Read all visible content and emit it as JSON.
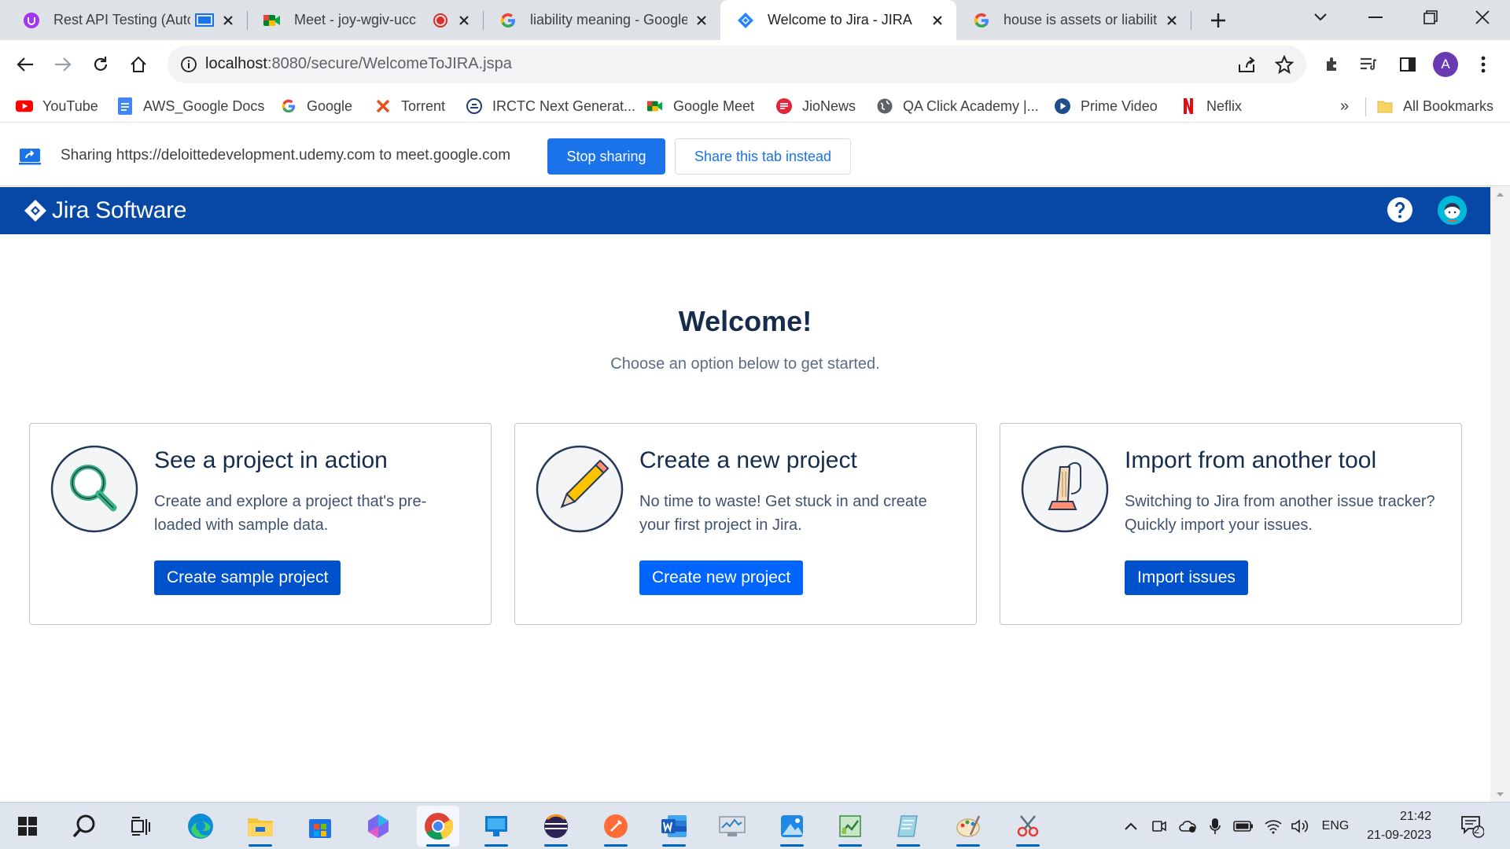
{
  "browser": {
    "tabs": [
      {
        "title": "Rest API Testing (Auto",
        "icon": "udemy-icon"
      },
      {
        "title": "Meet - joy-wgiv-ucc",
        "icon": "google-meet-icon"
      },
      {
        "title": "liability meaning - Google",
        "icon": "google-icon"
      },
      {
        "title": "Welcome to Jira - JIRA",
        "icon": "jira-icon",
        "active": true
      },
      {
        "title": "house is assets or liabilitie",
        "icon": "google-icon"
      }
    ],
    "url_host": "localhost",
    "url_path": ":8080/secure/WelcomeToJIRA.jspa",
    "profile_initial": "A"
  },
  "bookmarks": {
    "items": [
      {
        "label": "YouTube",
        "icon": "youtube-icon"
      },
      {
        "label": "AWS_Google Docs",
        "icon": "google-docs-icon"
      },
      {
        "label": "Google",
        "icon": "google-icon"
      },
      {
        "label": "Torrent",
        "icon": "torrent-icon"
      },
      {
        "label": "IRCTC Next Generat...",
        "icon": "irctc-icon"
      },
      {
        "label": "Google Meet",
        "icon": "google-meet-icon"
      },
      {
        "label": "JioNews",
        "icon": "jionews-icon"
      },
      {
        "label": "QA Click Academy |...",
        "icon": "globe-icon"
      },
      {
        "label": "Prime Video",
        "icon": "prime-video-icon"
      },
      {
        "label": "Neflix",
        "icon": "netflix-icon"
      }
    ],
    "overflow": "»",
    "all_bookmarks": "All Bookmarks"
  },
  "share_bar": {
    "text": "Sharing https://deloittedevelopment.udemy.com to meet.google.com",
    "stop_label": "Stop sharing",
    "share_tab_label": "Share this tab instead"
  },
  "jira": {
    "product_name": "Jira Software",
    "welcome_title": "Welcome!",
    "welcome_subtitle": "Choose an option below to get started.",
    "cards": [
      {
        "title": "See a project in action",
        "description": "Create and explore a project that's pre-loaded with sample data.",
        "button": "Create sample project"
      },
      {
        "title": "Create a new project",
        "description": "No time to waste! Get stuck in and create your first project in Jira.",
        "button": "Create new project"
      },
      {
        "title": "Import from another tool",
        "description": "Switching to Jira from another issue tracker? Quickly import your issues.",
        "button": "Import issues"
      }
    ]
  },
  "taskbar": {
    "language": "ENG",
    "time": "21:42",
    "date": "21-09-2023",
    "notification_count": "2"
  },
  "colors": {
    "jira_blue": "#0747a6",
    "button_blue": "#0052cc",
    "chrome_blue": "#1a73e8"
  }
}
